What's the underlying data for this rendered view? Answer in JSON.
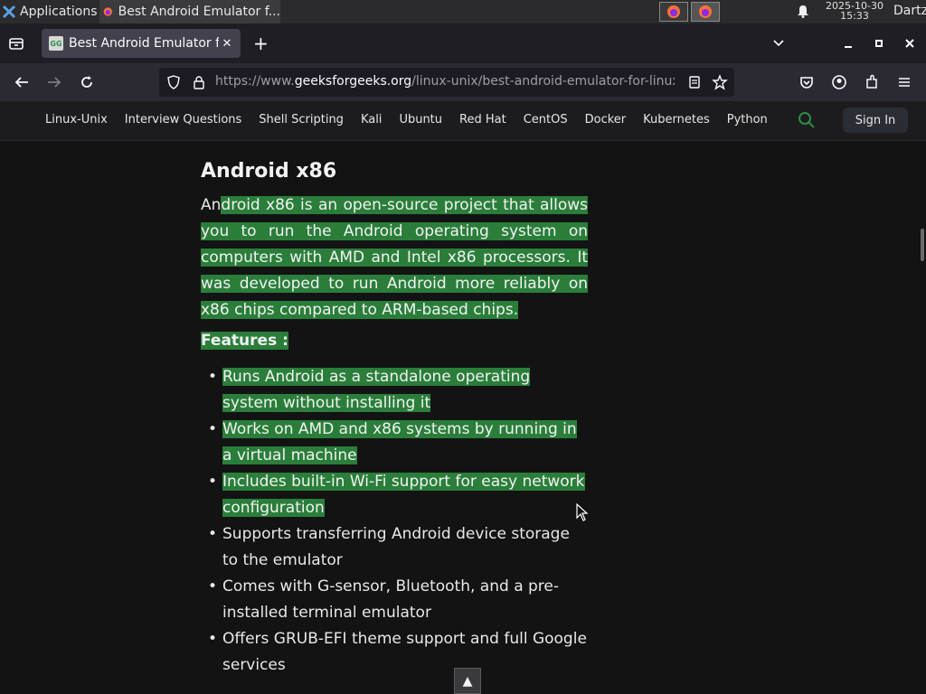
{
  "taskbar": {
    "apps_label": "Applications",
    "window_title": "Best Android Emulator f...",
    "clock_date": "2025-10-30",
    "clock_time": "15:33",
    "user": "Dartz"
  },
  "browser": {
    "tab_title": "Best Android Emulator for Linux",
    "url_prefix": "https://www.",
    "url_host": "geeksforgeeks.org",
    "url_path": "/linux-unix/best-android-emulator-for-linux"
  },
  "site_nav": {
    "links": [
      "Linux-Unix",
      "Interview Questions",
      "Shell Scripting",
      "Kali",
      "Ubuntu",
      "Red Hat",
      "CentOS",
      "Docker",
      "Kubernetes",
      "Python"
    ],
    "sign_in": "Sign In"
  },
  "article": {
    "heading": "Android x86",
    "para_lead": "An",
    "para_highlight": "droid x86 is an open-source project that allows you to run the Android operating system on computers with AMD and Intel x86 processors. It was developed to run Android more reliably on x86 chips compared to ARM-based chips.",
    "features_label": "Features :",
    "features": [
      "Runs Android as a standalone operating system without installing it",
      "Works on AMD and x86 systems by running in a virtual machine",
      "Includes built-in Wi-Fi support for easy network configuration",
      "Supports transferring Android device storage to the emulator",
      "Comes with G-sensor, Bluetooth, and a pre-installed terminal emulator",
      "Offers GRUB-EFI theme support and full Google services"
    ]
  },
  "colors": {
    "highlight": "#2a7e3a",
    "background": "#131314",
    "gfg_green": "#2f8d46"
  }
}
